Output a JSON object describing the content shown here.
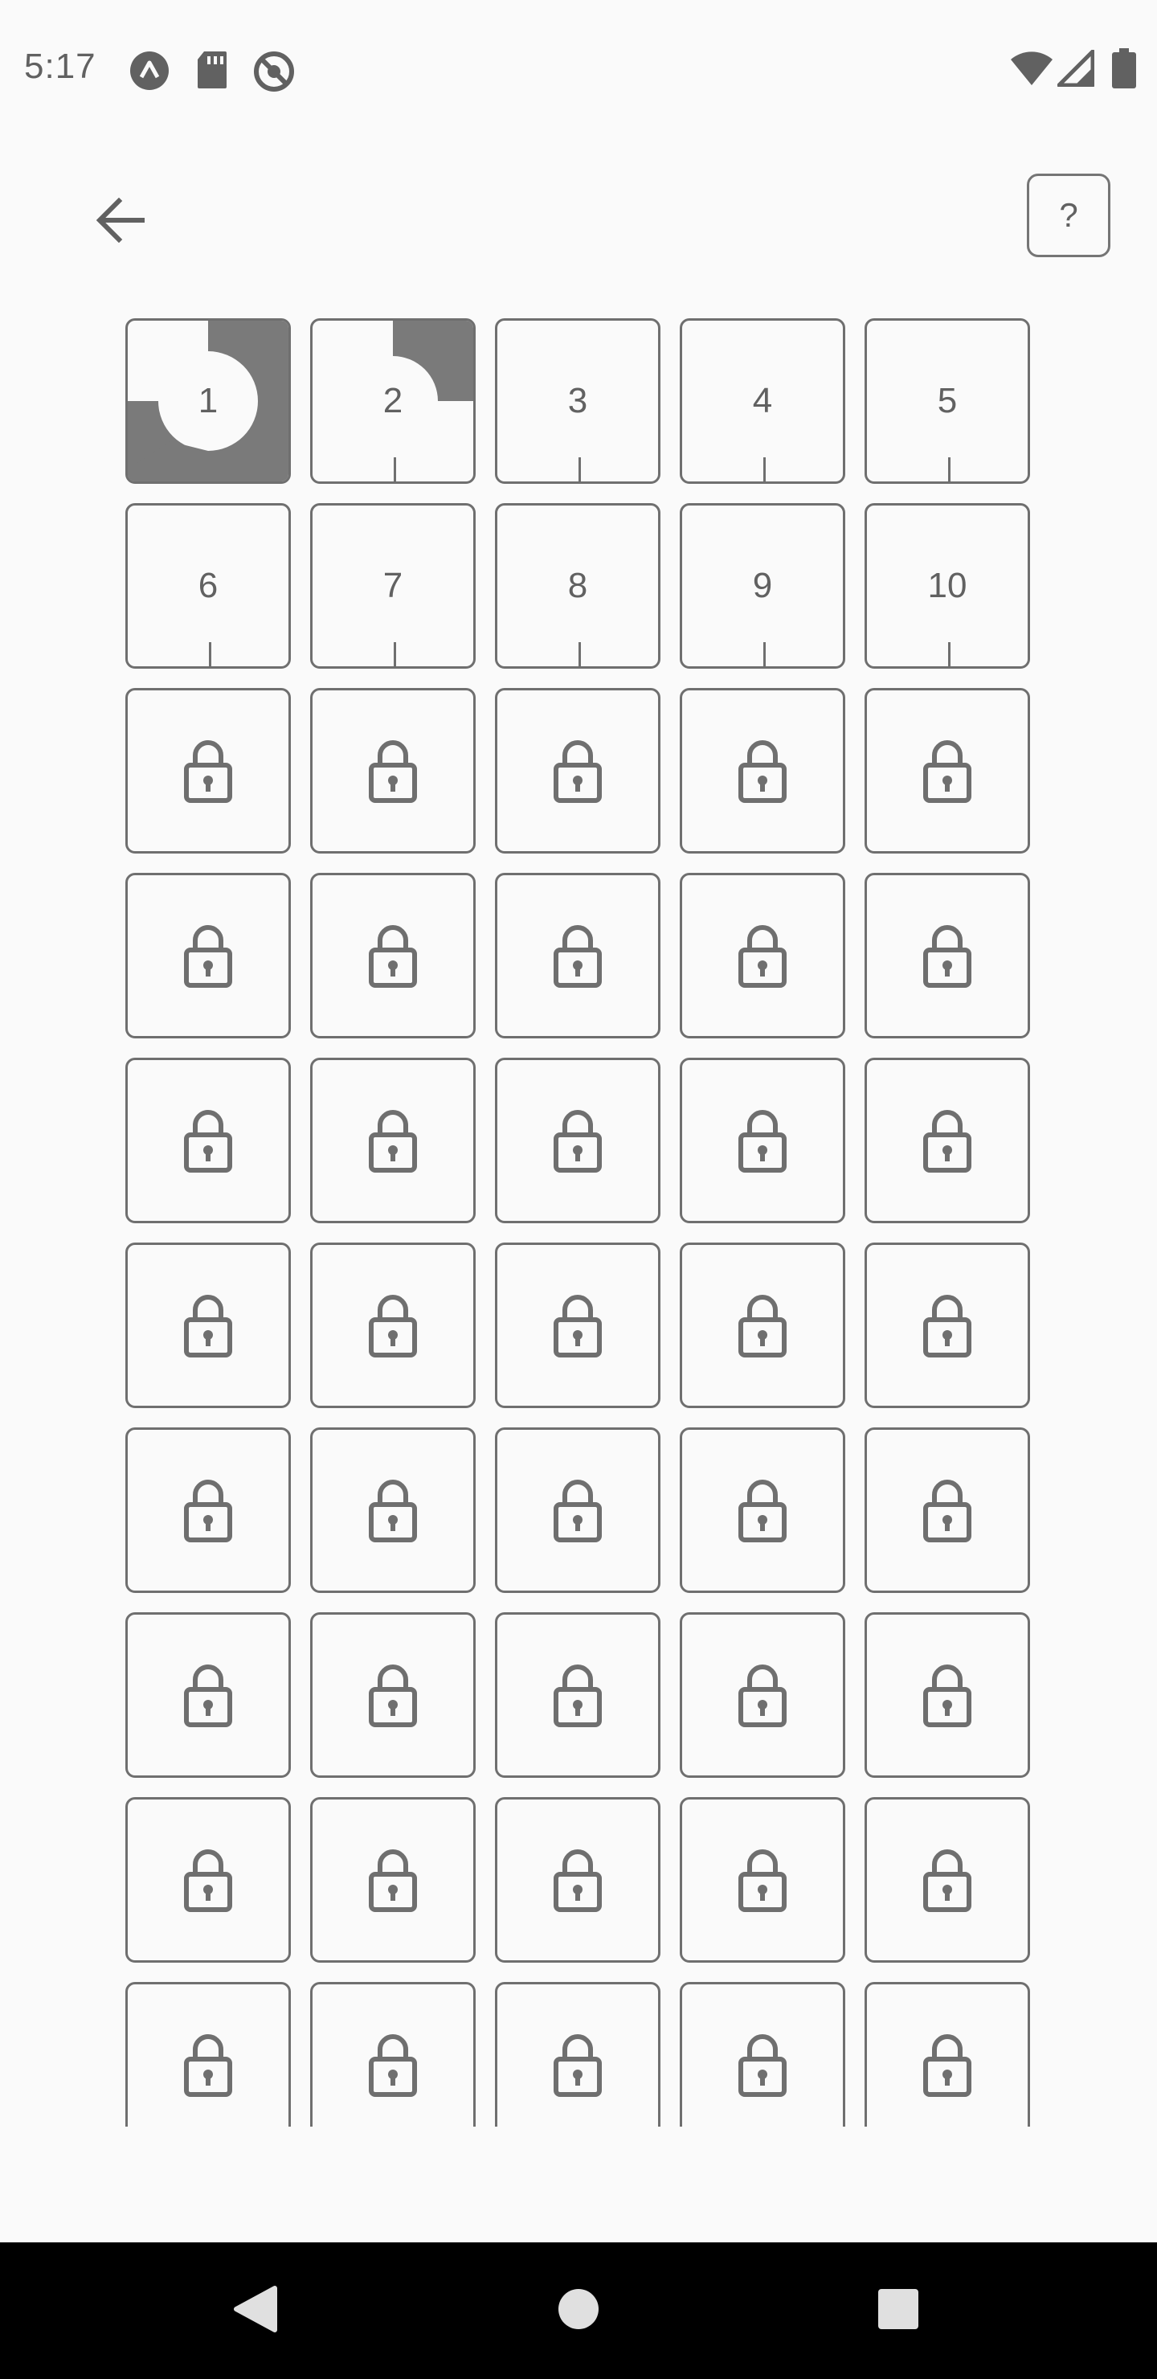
{
  "status_bar": {
    "time": "5:17",
    "left_icons": [
      "app-notification-icon",
      "sd-card-icon",
      "do-not-disturb-icon"
    ],
    "right_icons": [
      "wifi-icon",
      "cell-signal-icon",
      "battery-icon"
    ]
  },
  "app_bar": {
    "back_icon": "arrow-back-icon",
    "help_label": "?"
  },
  "levels": {
    "unlocked": [
      {
        "label": "1",
        "progress": 0.75
      },
      {
        "label": "2",
        "progress": 0.25
      },
      {
        "label": "3",
        "progress": 0
      },
      {
        "label": "4",
        "progress": 0
      },
      {
        "label": "5",
        "progress": 0
      },
      {
        "label": "6",
        "progress": 0
      },
      {
        "label": "7",
        "progress": 0
      },
      {
        "label": "8",
        "progress": 0
      },
      {
        "label": "9",
        "progress": 0
      },
      {
        "label": "10",
        "progress": 0
      }
    ],
    "locked_icon": "lock-icon"
  },
  "nav_bar": {
    "icons": [
      "back-triangle-icon",
      "home-circle-icon",
      "recents-square-icon"
    ]
  },
  "colors": {
    "background": "#fafafa",
    "tile_border": "#6f6f6f",
    "progress_fill": "#7a7a7a",
    "nav_bar": "#000000"
  }
}
